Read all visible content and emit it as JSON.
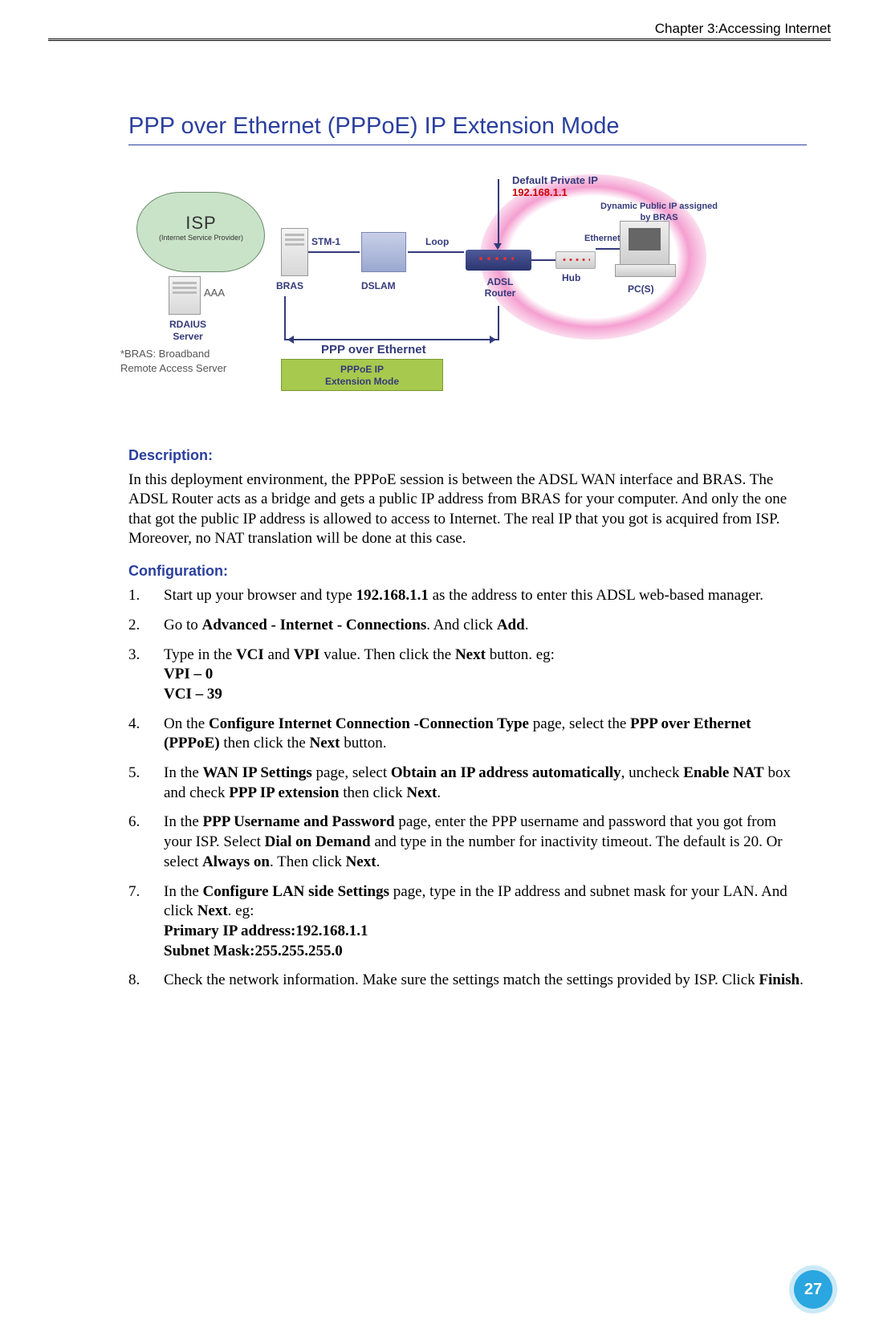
{
  "header": {
    "chapter": "Chapter 3:Accessing Internet"
  },
  "title": "PPP over Ethernet (PPPoE) IP Extension Mode",
  "diagram": {
    "isp": "ISP",
    "isp_sub": "(Internet Service Provider)",
    "rdaius": "RDAIUS\nServer",
    "aaa": "AAA",
    "bras": "BRAS",
    "stm1": "STM-1",
    "dslam": "DSLAM",
    "loop": "Loop",
    "adsl_router": "ADSL\nRouter",
    "hub": "Hub",
    "ethernet": "Ethernet",
    "pcs": "PC(S)",
    "default_ip_label": "Default Private IP",
    "default_ip_value": "192.168.1.1",
    "dyn_ip_label": "Dynamic Public IP assigned by BRAS",
    "ppp_label": "PPP over Ethernet",
    "mode_box": "PPPoE IP\nExtension Mode",
    "footnote": "*BRAS: Broadband\nRemote Access Server"
  },
  "description": {
    "heading": "Description:",
    "body": "In this deployment environment, the PPPoE session is between the ADSL WAN interface and BRAS. The ADSL Router acts as a bridge and gets a public IP address from BRAS for your computer. And only the one that got the public IP address is allowed to access to Internet. The real IP that you got is acquired from ISP. Moreover, no NAT translation will be done at this case."
  },
  "configuration": {
    "heading": "Configuration:",
    "steps": [
      {
        "n": "1.",
        "html": "Start up your browser and type <b>192.168.1.1</b> as the address to enter this ADSL web-based manager."
      },
      {
        "n": "2.",
        "html": "Go to <b>Advanced - Internet - Connections</b>. And click <b>Add</b>."
      },
      {
        "n": "3.",
        "html": "Type in the <b>VCI</b> and <b>VPI</b> value. Then click the <b>Next</b> button. eg:<br><b>VPI – 0</b><br><b>VCI – 39</b>"
      },
      {
        "n": "4.",
        "html": "On the <b>Configure Internet Connection -Connection Type</b> page, select the <b>PPP over Ethernet (PPPoE)</b> then click the <b>Next</b> button."
      },
      {
        "n": "5.",
        "html": "In the <b>WAN IP Settings</b> page, select <b>Obtain an IP address automatically</b>, uncheck <b>Enable NAT</b> box and check <b>PPP IP extension</b> then click <b>Next</b>."
      },
      {
        "n": "6.",
        "html": "In the <b>PPP Username and Password</b> page, enter the PPP username and password that you got from your ISP. Select <b>Dial on Demand</b> and type in the number for inactivity timeout. The default is 20. Or select <b>Always on</b>. Then click <b>Next</b>."
      },
      {
        "n": "7.",
        "html": "In the <b>Configure LAN side Settings</b> page, type in the IP address and subnet mask for your LAN. And click <b>Next</b>. eg:<br><b>Primary IP address:192.168.1.1</b><br><b>Subnet Mask:255.255.255.0</b>"
      },
      {
        "n": "8.",
        "html": "Check the network information. Make sure the settings match the settings provided by ISP. Click <b>Finish</b>."
      }
    ]
  },
  "page_number": "27"
}
